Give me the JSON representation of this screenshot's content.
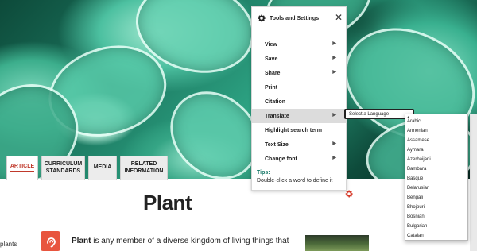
{
  "tabs": [
    {
      "label": "ARTICLE",
      "active": true
    },
    {
      "label": "CURRICULUM STANDARDS",
      "active": false
    },
    {
      "label": "MEDIA",
      "active": false
    },
    {
      "label": "RELATED INFORMATION",
      "active": false
    }
  ],
  "article": {
    "title": "Plant",
    "sidebar_label": "plants",
    "lead_bold": "Plant",
    "lead_rest": " is any member of a diverse kingdom of living things that"
  },
  "tools": {
    "title": "Tools and Settings",
    "close": "✕",
    "menu": [
      {
        "label": "View",
        "has_submenu": true
      },
      {
        "label": "Save",
        "has_submenu": true
      },
      {
        "label": "Share",
        "has_submenu": true
      },
      {
        "label": "Print",
        "has_submenu": false
      },
      {
        "label": "Citation",
        "has_submenu": false
      },
      {
        "label": "Translate",
        "has_submenu": true,
        "highlighted": true
      },
      {
        "label": "Highlight search term",
        "has_submenu": false
      },
      {
        "label": "Text Size",
        "has_submenu": true
      },
      {
        "label": "Change font",
        "has_submenu": true
      }
    ],
    "tips_label": "Tips:",
    "tips_text": "Double-click a word to define it"
  },
  "translate": {
    "select_label": "Select a Language",
    "languages": [
      "Arabic",
      "Armenian",
      "Assamese",
      "Aymara",
      "Azerbaijani",
      "Bambara",
      "Basque",
      "Belarusian",
      "Bengali",
      "Bhojpuri",
      "Bosnian",
      "Bulgarian",
      "Catalan"
    ]
  },
  "colors": {
    "accent": "#c0392b",
    "tips": "#197a6a",
    "audio_button": "#e8553e",
    "gear_icon": "#d63a2a"
  },
  "icons": {
    "gear": "gear-icon",
    "close": "close-icon",
    "audio": "audio-icon",
    "submenu": "chevron-right-icon"
  }
}
